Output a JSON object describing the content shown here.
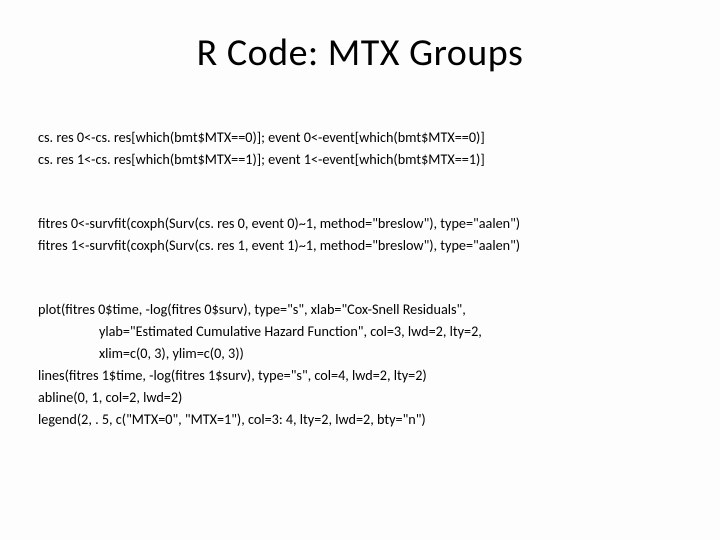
{
  "title": "R Code: MTX Groups",
  "block1": {
    "l1": "cs. res 0<-cs. res[which(bmt$MTX==0)]; event 0<-event[which(bmt$MTX==0)]",
    "l2": "cs. res 1<-cs. res[which(bmt$MTX==1)]; event 1<-event[which(bmt$MTX==1)]"
  },
  "block2": {
    "l1": "fitres 0<-survfit(coxph(Surv(cs. res 0, event 0)~1, method=\"breslow\"), type=\"aalen\")",
    "l2": "fitres 1<-survfit(coxph(Surv(cs. res 1, event 1)~1, method=\"breslow\"), type=\"aalen\")"
  },
  "block3": {
    "l1": "plot(fitres 0$time, -log(fitres 0$surv), type=\"s\", xlab=\"Cox-Snell Residuals\",",
    "l2": "                   ylab=\"Estimated Cumulative Hazard Function\", col=3, lwd=2, lty=2,",
    "l3": "                   xlim=c(0, 3), ylim=c(0, 3))",
    "l4": "lines(fitres 1$time, -log(fitres 1$surv), type=\"s\", col=4, lwd=2, lty=2)",
    "l5": "abline(0, 1, col=2, lwd=2)",
    "l6": "legend(2, . 5, c(\"MTX=0\", \"MTX=1\"), col=3: 4, lty=2, lwd=2, bty=\"n\")"
  }
}
